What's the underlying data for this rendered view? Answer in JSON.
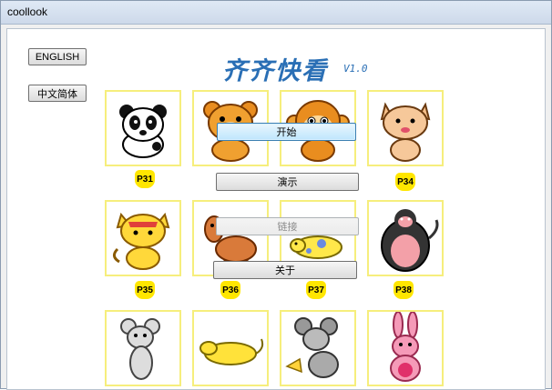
{
  "window": {
    "title": "coollook"
  },
  "header": {
    "title": "齐齐快看",
    "version": "V1.0"
  },
  "language": {
    "english_label": "ENGLISH",
    "chinese_label": "中文简体"
  },
  "menu": {
    "start_label": "开始",
    "demo_label": "演示",
    "link_label": "链接",
    "about_label": "关于"
  },
  "cards": [
    {
      "icon": "panda-icon",
      "label": "P31"
    },
    {
      "icon": "bear-icon",
      "label": ""
    },
    {
      "icon": "monkey-icon",
      "label": ""
    },
    {
      "icon": "cat-icon",
      "label": "P34"
    },
    {
      "icon": "tabby-cat-icon",
      "label": "P35"
    },
    {
      "icon": "horse-icon",
      "label": "P36"
    },
    {
      "icon": "cow-icon",
      "label": "P37"
    },
    {
      "icon": "gorilla-icon",
      "label": "P38"
    },
    {
      "icon": "mouse-icon",
      "label": ""
    },
    {
      "icon": "sleeping-mouse-icon",
      "label": ""
    },
    {
      "icon": "grey-mouse-icon",
      "label": ""
    },
    {
      "icon": "rabbit-icon",
      "label": ""
    }
  ]
}
